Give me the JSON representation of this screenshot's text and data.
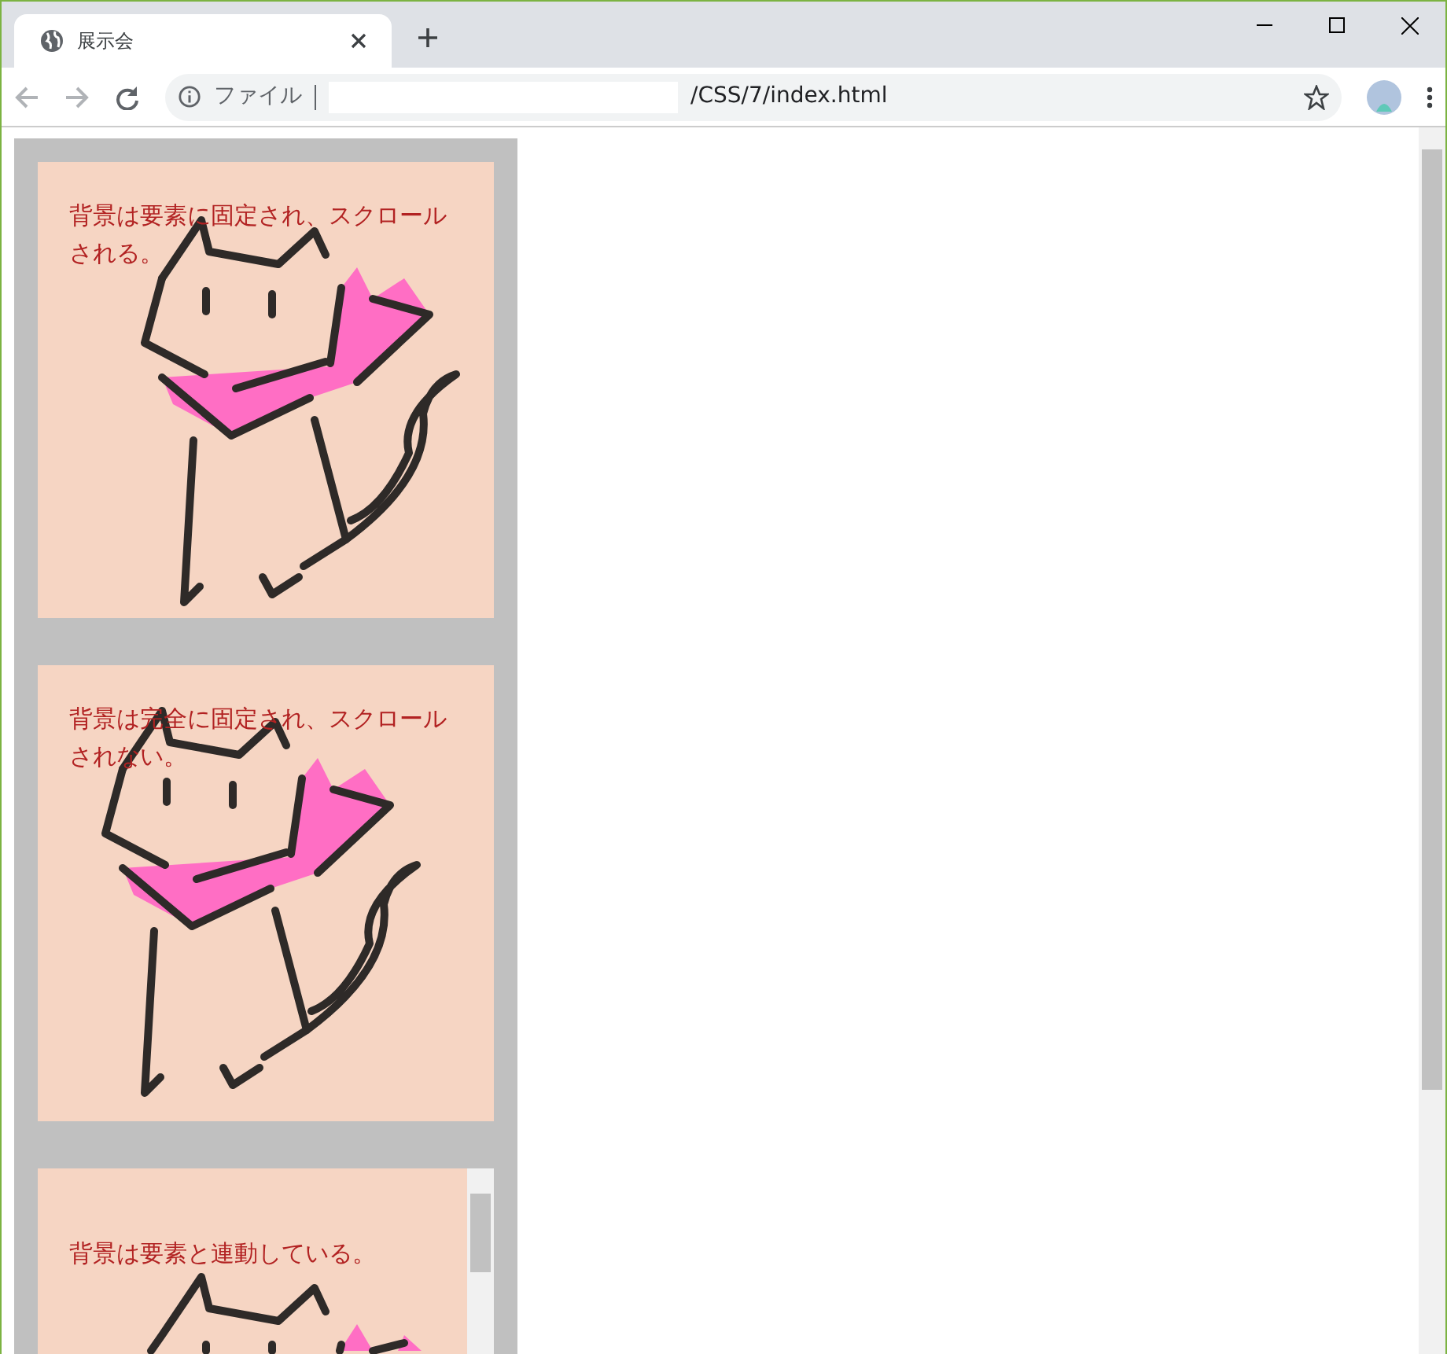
{
  "tab": {
    "title": "展示会",
    "selected": true
  },
  "address_bar": {
    "scheme_label": "ファイル",
    "url": "/CSS/7/index.html"
  },
  "panels": [
    {
      "kind": "scroll",
      "caption": "背景は要素に固定され、スクロールされる。"
    },
    {
      "kind": "fixed",
      "caption": "背景は完全に固定され、スクロールされない。"
    },
    {
      "kind": "local",
      "caption": "背景は要素と連動している。"
    }
  ]
}
